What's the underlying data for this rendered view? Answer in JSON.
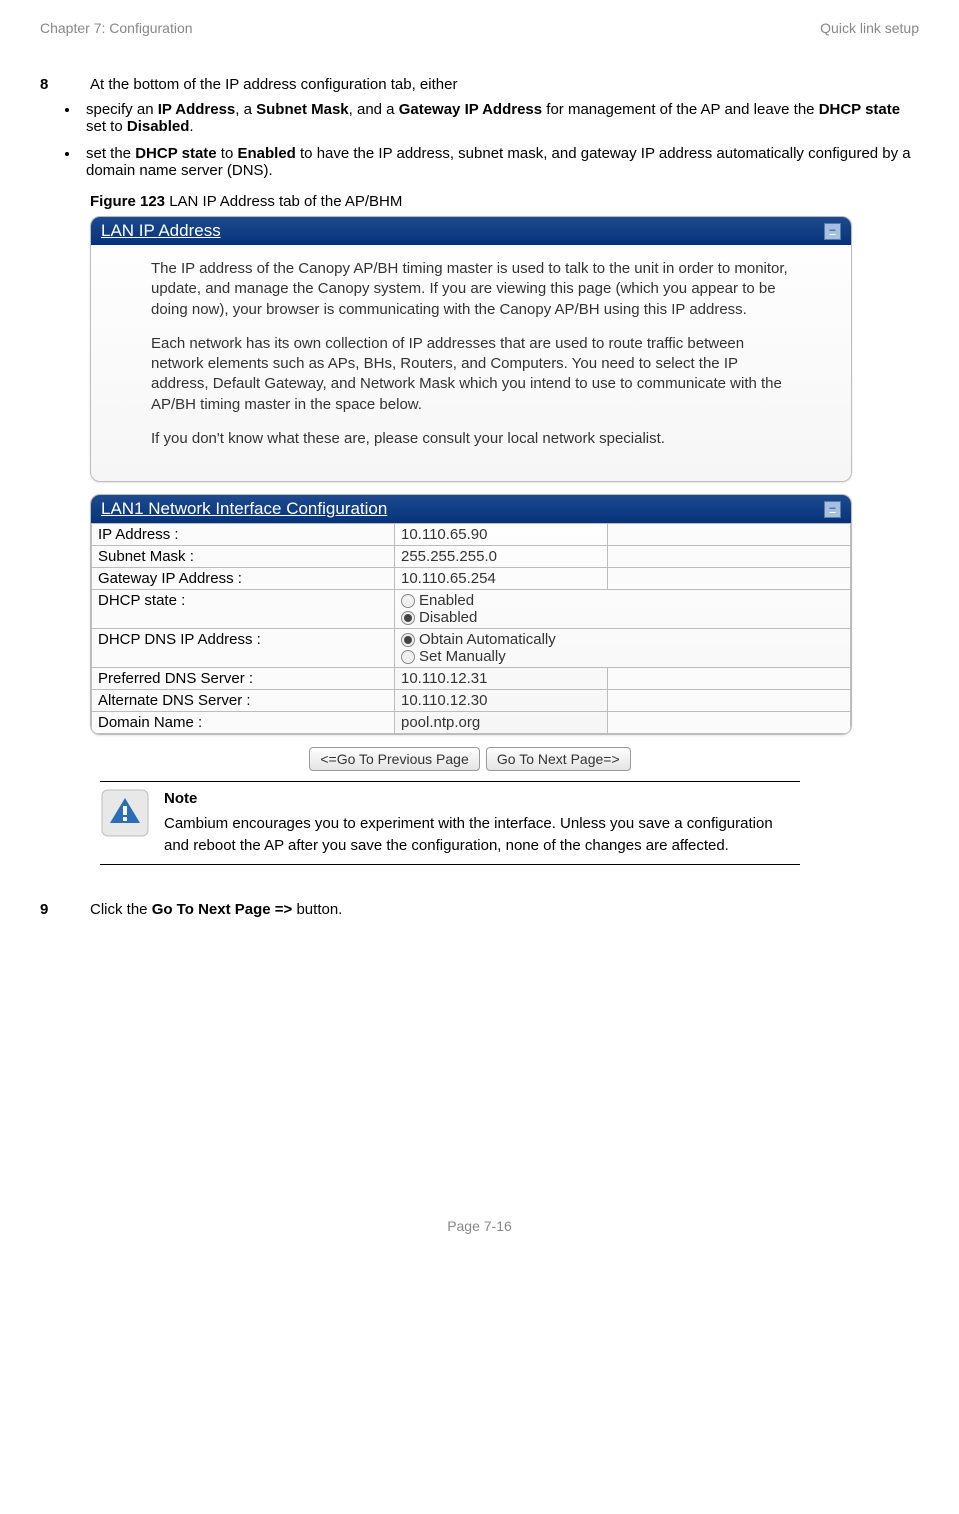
{
  "header": {
    "left": "Chapter 7:  Configuration",
    "right": "Quick link setup"
  },
  "step8": {
    "num": "8",
    "intro": "At the bottom of the IP address configuration tab, either",
    "bullets": [
      {
        "pre": "specify an ",
        "b1": "IP Address",
        "mid1": ", a ",
        "b2": "Subnet Mask",
        "mid2": ", and a ",
        "b3": "Gateway IP Address",
        "mid3": " for management of the AP and leave the ",
        "b4": "DHCP state",
        "mid4": " set to ",
        "b5": "Disabled",
        "post": "."
      },
      {
        "pre": "set the ",
        "b1": "DHCP state",
        "mid1": " to ",
        "b2": "Enabled",
        "post": " to have the IP address, subnet mask, and gateway IP address automatically configured by a domain name server (DNS)."
      }
    ],
    "figure_b": "Figure 123",
    "figure_rest": " LAN IP Address tab of the AP/BHM"
  },
  "panel1": {
    "title": "LAN IP Address",
    "p1": "The IP address of the Canopy AP/BH timing master is used to talk to the unit in order to monitor, update, and manage the Canopy system. If you are viewing this page (which you appear to be doing now), your browser is communicating with the Canopy AP/BH using this IP address.",
    "p2": "Each network has its own collection of IP addresses that are used to route traffic between network elements such as APs, BHs, Routers, and Computers. You need to select the IP address, Default Gateway, and Network Mask which you intend to use to communicate with the AP/BH timing master in the space below.",
    "p3": "If you don't know what these are, please consult your local network specialist."
  },
  "panel2": {
    "title": "LAN1 Network Interface Configuration",
    "rows": {
      "ip_label": "IP Address :",
      "ip_value": "10.110.65.90",
      "subnet_label": "Subnet Mask :",
      "subnet_value": "255.255.255.0",
      "gateway_label": "Gateway IP Address :",
      "gateway_value": "10.110.65.254",
      "dhcp_label": "DHCP state :",
      "dhcp_enabled": "Enabled",
      "dhcp_disabled": "Disabled",
      "dns_mode_label": "DHCP DNS IP Address :",
      "dns_auto": "Obtain Automatically",
      "dns_manual": "Set Manually",
      "pref_dns_label": "Preferred DNS Server :",
      "pref_dns_value": "10.110.12.31",
      "alt_dns_label": "Alternate DNS Server :",
      "alt_dns_value": "10.110.12.30",
      "domain_label": "Domain Name :",
      "domain_value": "pool.ntp.org"
    }
  },
  "nav": {
    "prev": "<=Go To Previous Page",
    "next": "Go To Next Page=>"
  },
  "note": {
    "title": "Note",
    "body": "Cambium encourages you to experiment with the interface. Unless you save a configuration and reboot the AP after you save the configuration, none of the changes are affected."
  },
  "step9": {
    "num": "9",
    "pre": "Click the ",
    "b": "Go To Next Page =>",
    "post": " button."
  },
  "footer": "Page 7-16"
}
